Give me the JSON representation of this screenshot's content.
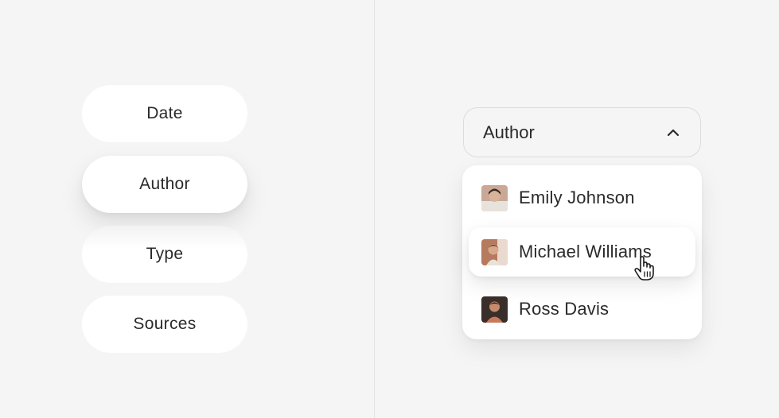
{
  "filters": {
    "items": [
      {
        "label": "Date"
      },
      {
        "label": "Author"
      },
      {
        "label": "Type"
      },
      {
        "label": "Sources"
      }
    ]
  },
  "dropdown": {
    "selected_label": "Author",
    "icon": "chevron-up-icon",
    "options": [
      {
        "name": "Emily Johnson",
        "avatar_colors": [
          "#c9a895",
          "#3b2a22",
          "#e8e2dc"
        ]
      },
      {
        "name": "Michael Williams",
        "avatar_colors": [
          "#b67a5e",
          "#e9d9cf",
          "#5a3b2b"
        ]
      },
      {
        "name": "Ross Davis",
        "avatar_colors": [
          "#3a2e2a",
          "#c97a5a",
          "#1f1a18"
        ]
      }
    ],
    "hovered_option": "Michael Williams"
  },
  "colors": {
    "background": "#f5f5f5",
    "surface": "#ffffff",
    "text": "#2a2a2a",
    "border": "#dcdcdc"
  }
}
